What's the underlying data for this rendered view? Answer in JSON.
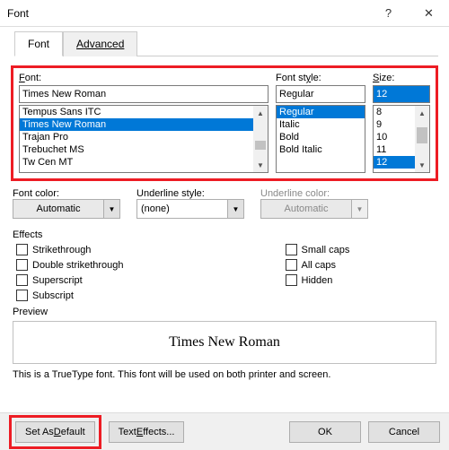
{
  "titlebar": {
    "title": "Font",
    "help": "?",
    "close": "✕"
  },
  "tabs": {
    "font": "Font",
    "advanced": "Advanced"
  },
  "labels": {
    "font": "Font:",
    "font_u": "F",
    "fontstyle": "Font style:",
    "fontstyle_u": "y",
    "size": "Size:",
    "size_u": "S",
    "font_color": "Font color:",
    "underline_style": "Underline style:",
    "underline_color": "Underline color:",
    "effects": "Effects",
    "preview": "Preview"
  },
  "font": {
    "value": "Times New Roman",
    "list": [
      "Tempus Sans ITC",
      "Times New Roman",
      "Trajan Pro",
      "Trebuchet MS",
      "Tw Cen MT"
    ],
    "selected_index": 1
  },
  "style": {
    "value": "Regular",
    "list": [
      "Regular",
      "Italic",
      "Bold",
      "Bold Italic"
    ],
    "selected_index": 0
  },
  "size": {
    "value": "12",
    "list": [
      "8",
      "9",
      "10",
      "11",
      "12"
    ],
    "selected_index": 4
  },
  "color": {
    "font_color": "Automatic",
    "underline_style": "(none)",
    "underline_color": "Automatic"
  },
  "effects": {
    "strike": "Strikethrough",
    "dblstrike": "Double strikethrough",
    "superscript": "Superscript",
    "subscript": "Subscript",
    "smallcaps": "Small caps",
    "allcaps": "All caps",
    "hidden": "Hidden"
  },
  "preview": {
    "text": "Times New Roman"
  },
  "hint": "This is a TrueType font. This font will be used on both printer and screen.",
  "buttons": {
    "set_default": "Set As Default",
    "text_effects": "Text Effects...",
    "ok": "OK",
    "cancel": "Cancel"
  }
}
